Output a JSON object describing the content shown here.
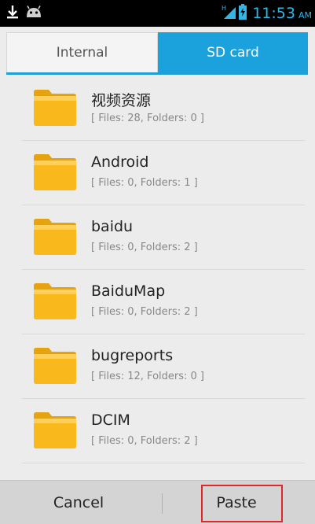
{
  "status_bar": {
    "left_icons": [
      "download-icon",
      "android-icon"
    ],
    "right_icons": [
      "signal-icon",
      "battery-charging-icon"
    ],
    "time": "11:53",
    "ampm": "AM",
    "network_letter": "H"
  },
  "tabs": [
    {
      "label": "Internal",
      "selected": false
    },
    {
      "label": "SD card",
      "selected": true
    }
  ],
  "folders": [
    {
      "name": "视频资源",
      "info": "[ Files: 28, Folders: 0 ]"
    },
    {
      "name": "Android",
      "info": "[ Files: 0, Folders: 1 ]"
    },
    {
      "name": "baidu",
      "info": "[ Files: 0, Folders: 2 ]"
    },
    {
      "name": "BaiduMap",
      "info": "[ Files: 0, Folders: 2 ]"
    },
    {
      "name": "bugreports",
      "info": "[ Files: 12, Folders: 0 ]"
    },
    {
      "name": "DCIM",
      "info": "[ Files: 0, Folders: 2 ]"
    }
  ],
  "bottom_bar": {
    "cancel_label": "Cancel",
    "paste_label": "Paste"
  },
  "colors": {
    "accent": "#1ba1dc",
    "time": "#33b5e5",
    "folder": "#f9b81c",
    "highlight": "#e0262a"
  }
}
